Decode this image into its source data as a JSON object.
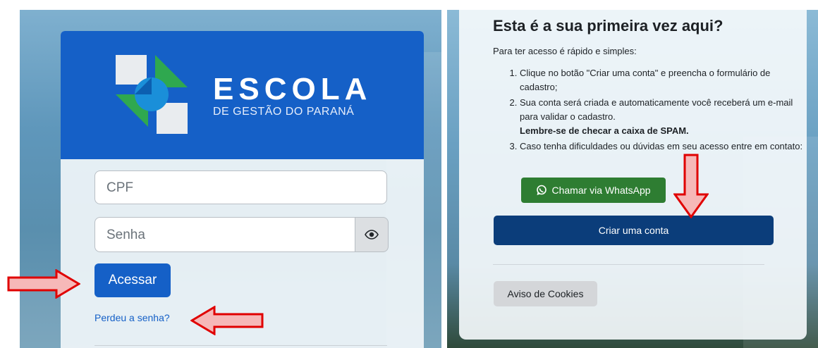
{
  "login": {
    "logo_title": "ESCOLA",
    "logo_subtitle": "DE GESTÃO DO PARANÁ",
    "cpf_placeholder": "CPF",
    "password_placeholder": "Senha",
    "submit_label": "Acessar",
    "lost_password_link": "Perdeu a senha?"
  },
  "signup": {
    "heading": "Esta é a sua primeira vez aqui?",
    "intro": "Para ter acesso é rápido e simples:",
    "step1": "Clique no botão \"Criar uma conta\" e preencha o formulário de cadastro;",
    "step2": "Sua conta será criada e automaticamente você receberá um e-mail para validar o cadastro.",
    "step2_bold": "Lembre-se de checar a caixa de SPAM.",
    "step3": "Caso tenha dificuldades ou dúvidas em seu acesso entre em contato:",
    "whatsapp_label": "Chamar via WhatsApp",
    "create_account_label": "Criar uma conta",
    "cookies_label": "Aviso de Cookies"
  },
  "colors": {
    "brand_blue": "#1560c7",
    "dark_blue": "#0b3d7a",
    "whatsapp_green": "#2e7d32",
    "arrow_red": "#e00000"
  }
}
